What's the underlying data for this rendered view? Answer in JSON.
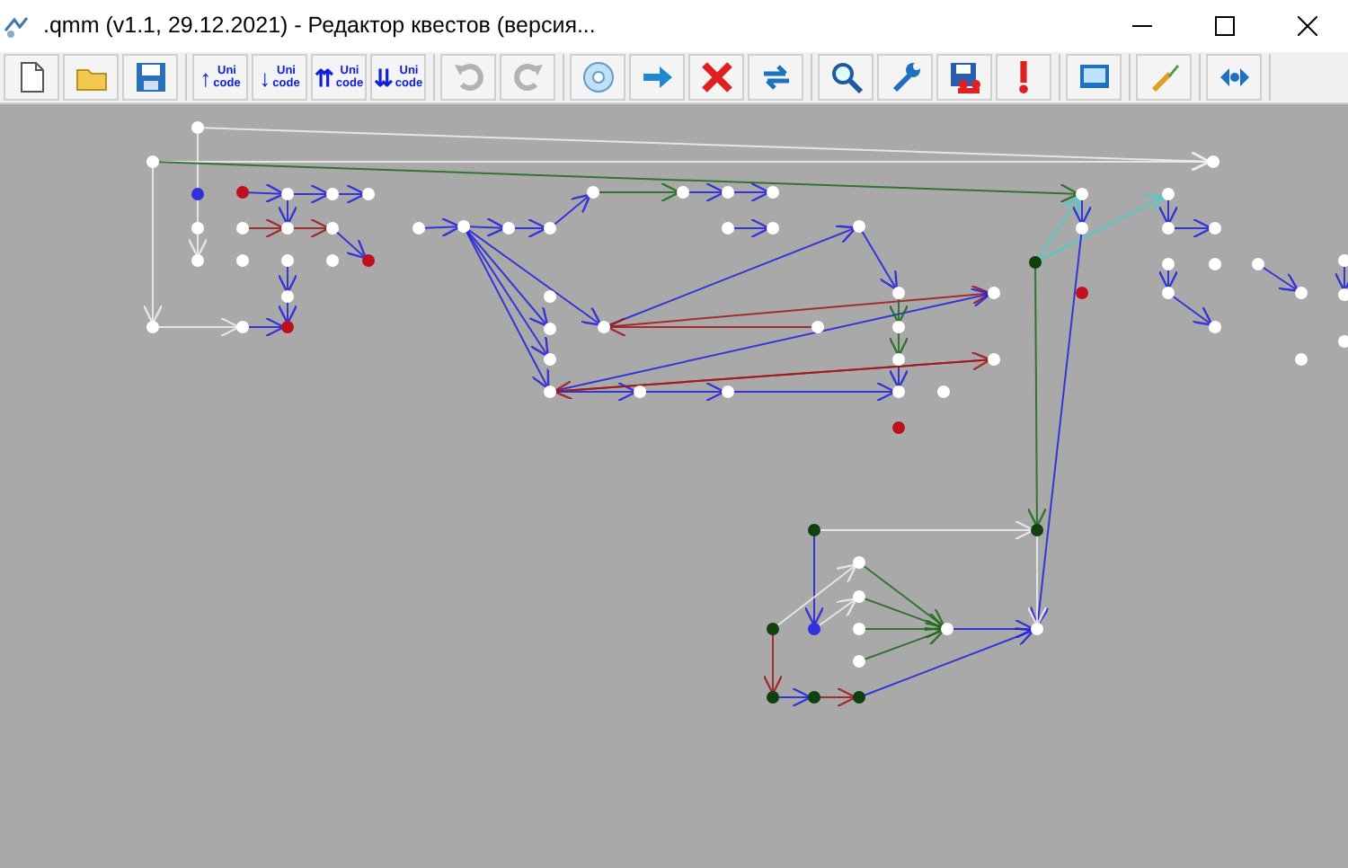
{
  "window": {
    "title": ".qmm (v1.1, 29.12.2021)  - Редактор квестов (версия..."
  },
  "toolbar": {
    "groups": [
      {
        "buttons": [
          {
            "disabled": false
          },
          {
            "disabled": false
          },
          {
            "disabled": false
          }
        ]
      },
      {
        "buttons": [
          {
            "arrow": "↑",
            "line_1": "Uni",
            "line_2": "code",
            "disabled": false
          },
          {
            "arrow": "↓",
            "line_1": "Uni",
            "line_2": "code",
            "disabled": false
          },
          {
            "arrow": "⇈",
            "line_1": "Uni",
            "line_2": "code",
            "disabled": false
          },
          {
            "arrow": "⇊",
            "line_1": "Uni",
            "line_2": "code",
            "disabled": false
          }
        ]
      },
      {
        "buttons": [
          {
            "disabled": true
          },
          {
            "disabled": true
          }
        ]
      },
      {
        "buttons": [
          {
            "disabled": false
          },
          {
            "disabled": false
          },
          {
            "disabled": false
          },
          {
            "disabled": false
          }
        ]
      },
      {
        "buttons": [
          {
            "disabled": false
          },
          {
            "disabled": false
          },
          {
            "disabled": false
          },
          {
            "disabled": false
          }
        ]
      },
      {
        "buttons": [
          {
            "disabled": false
          }
        ]
      },
      {
        "buttons": [
          {
            "disabled": false
          }
        ]
      },
      {
        "buttons": [
          {
            "disabled": false
          }
        ]
      }
    ]
  }
}
